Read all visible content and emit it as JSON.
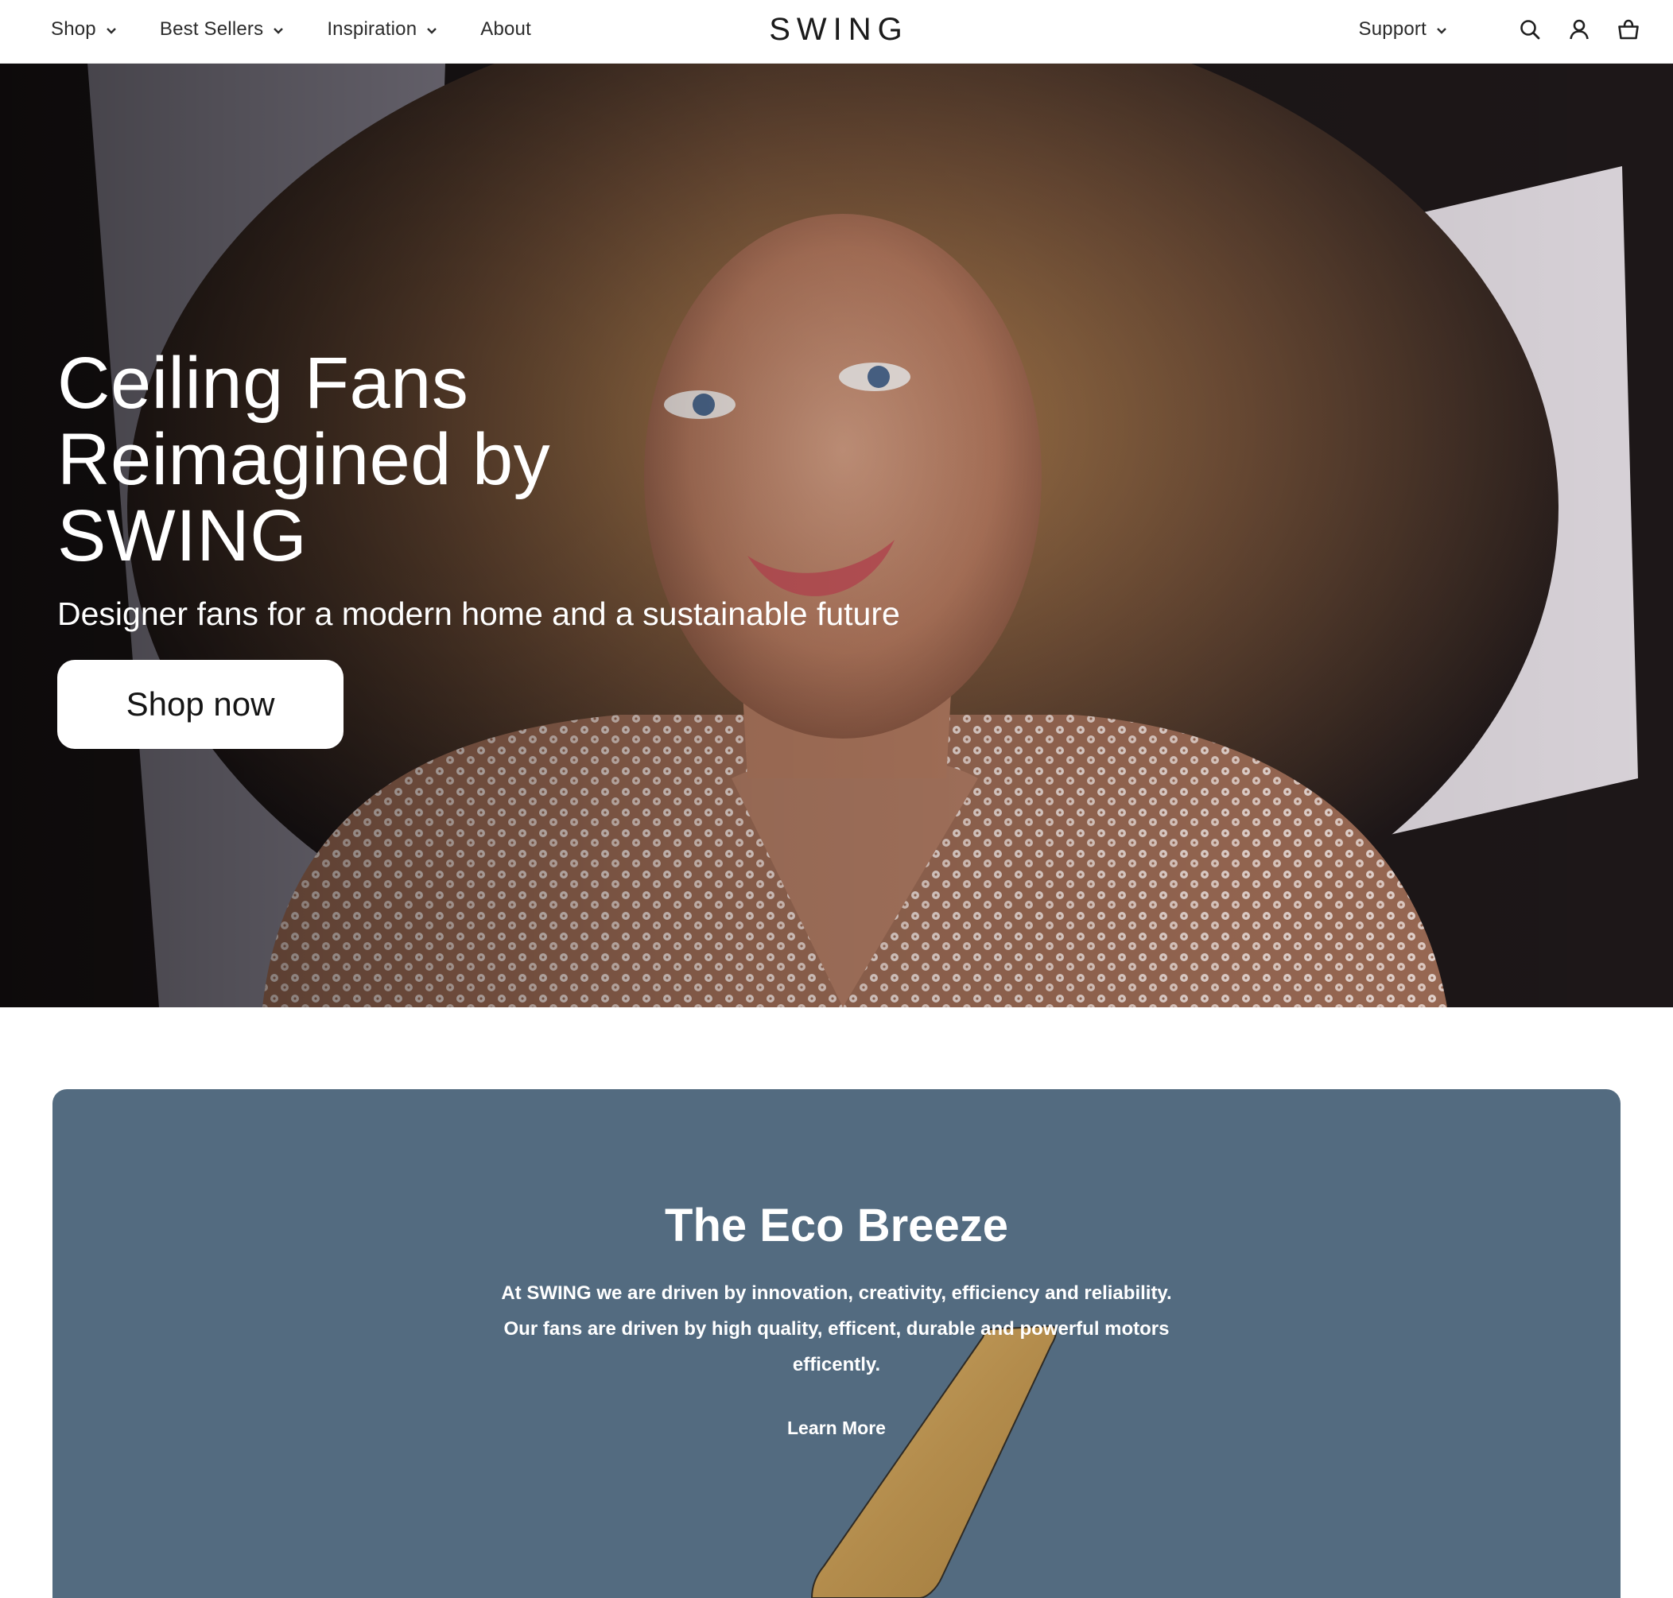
{
  "header": {
    "nav_left": [
      {
        "label": "Shop",
        "has_dropdown": true
      },
      {
        "label": "Best Sellers",
        "has_dropdown": true
      },
      {
        "label": "Inspiration",
        "has_dropdown": true
      },
      {
        "label": "About",
        "has_dropdown": false
      }
    ],
    "logo": "SWING",
    "support": {
      "label": "Support",
      "has_dropdown": true
    },
    "icons": [
      "search-icon",
      "account-icon",
      "cart-icon"
    ]
  },
  "hero": {
    "title": "Ceiling Fans\nReimagined by\nSWING",
    "subtitle": "Designer fans for a modern home and a sustainable future",
    "cta_label": "Shop now"
  },
  "eco_breeze": {
    "title": "The Eco Breeze",
    "description": "At SWING we are driven by innovation, creativity, efficiency and reliability. Our fans are driven by high quality, efficent, durable and powerful motors efficently.",
    "link_label": "Learn More"
  },
  "colors": {
    "header_bg": "#ffffff",
    "card_bg": "#536b80",
    "blade": "#b8924f",
    "text_on_dark": "#ffffff"
  }
}
